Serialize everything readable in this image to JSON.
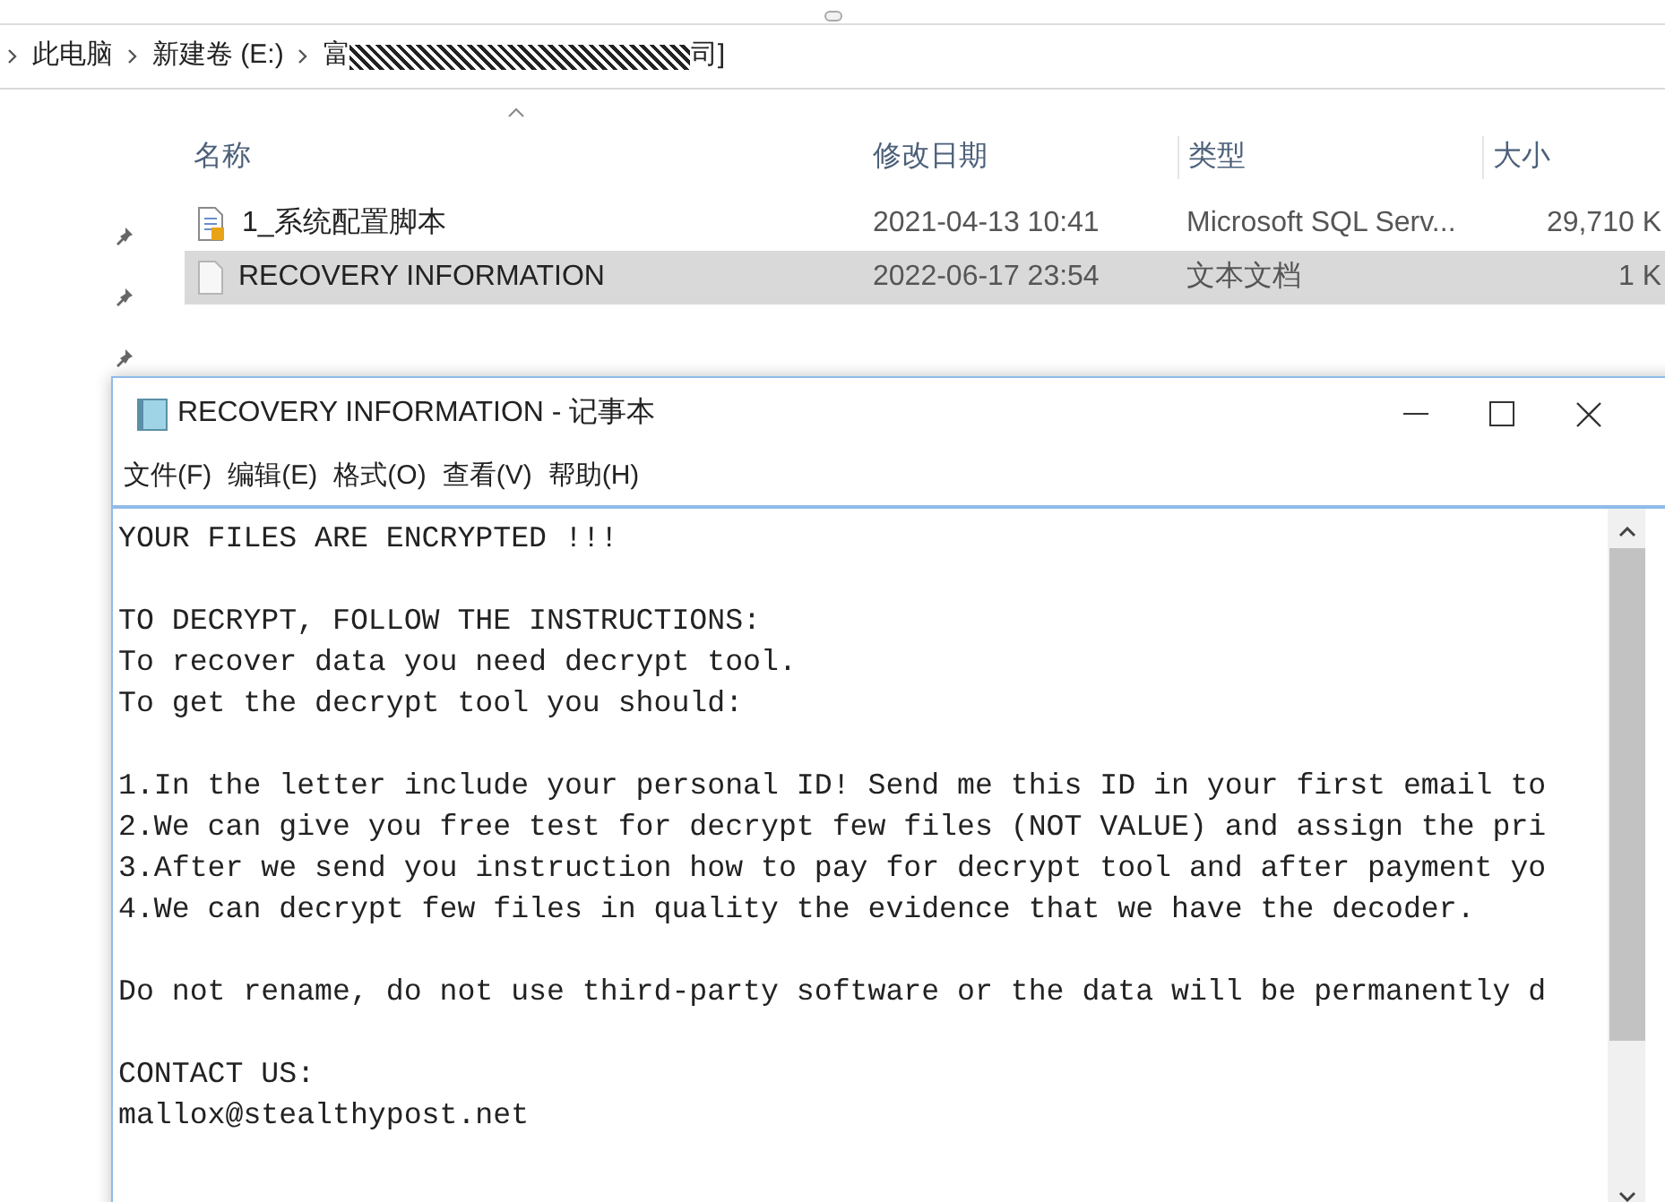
{
  "explorer": {
    "breadcrumb": [
      {
        "kind": "plain",
        "label": "此电脑"
      },
      {
        "kind": "plain",
        "label": "新建卷 (E:)"
      },
      {
        "kind": "redacted",
        "prefix": "富",
        "suffix": "司]"
      }
    ],
    "columns": [
      "名称",
      "修改日期",
      "类型",
      "大小"
    ],
    "rows": [
      {
        "kind": "script",
        "name": "1_系统配置脚本",
        "date": "2021-04-13 10:41",
        "type": "Microsoft SQL Serv...",
        "size": "29,710 K",
        "selected": false
      },
      {
        "kind": "text",
        "name": "RECOVERY INFORMATION",
        "date": "2022-06-17 23:54",
        "type": "文本文档",
        "size": "1 K",
        "selected": true
      }
    ]
  },
  "notepad": {
    "title": "RECOVERY INFORMATION - 记事本",
    "menu": [
      "文件(F)",
      "编辑(E)",
      "格式(O)",
      "查看(V)",
      "帮助(H)"
    ],
    "paragraphs": [
      [
        "YOUR FILES ARE ENCRYPTED !!!"
      ],
      [
        "TO DECRYPT, FOLLOW THE INSTRUCTIONS:",
        "To recover data you need decrypt tool.",
        "To get the decrypt tool you should:"
      ],
      [
        "1.In the letter include your personal ID! Send me this ID in your first email to",
        "2.We can give you free test for decrypt few files (NOT VALUE) and assign the pri",
        "3.After we send you instruction how to pay for decrypt tool and after payment yo",
        "4.We can decrypt few files in quality the evidence that we have the decoder."
      ],
      [
        "Do not rename, do not use third-party software or the data will be permanently d"
      ],
      [
        "CONTACT US:",
        "mallox@stealthypost.net"
      ]
    ]
  }
}
